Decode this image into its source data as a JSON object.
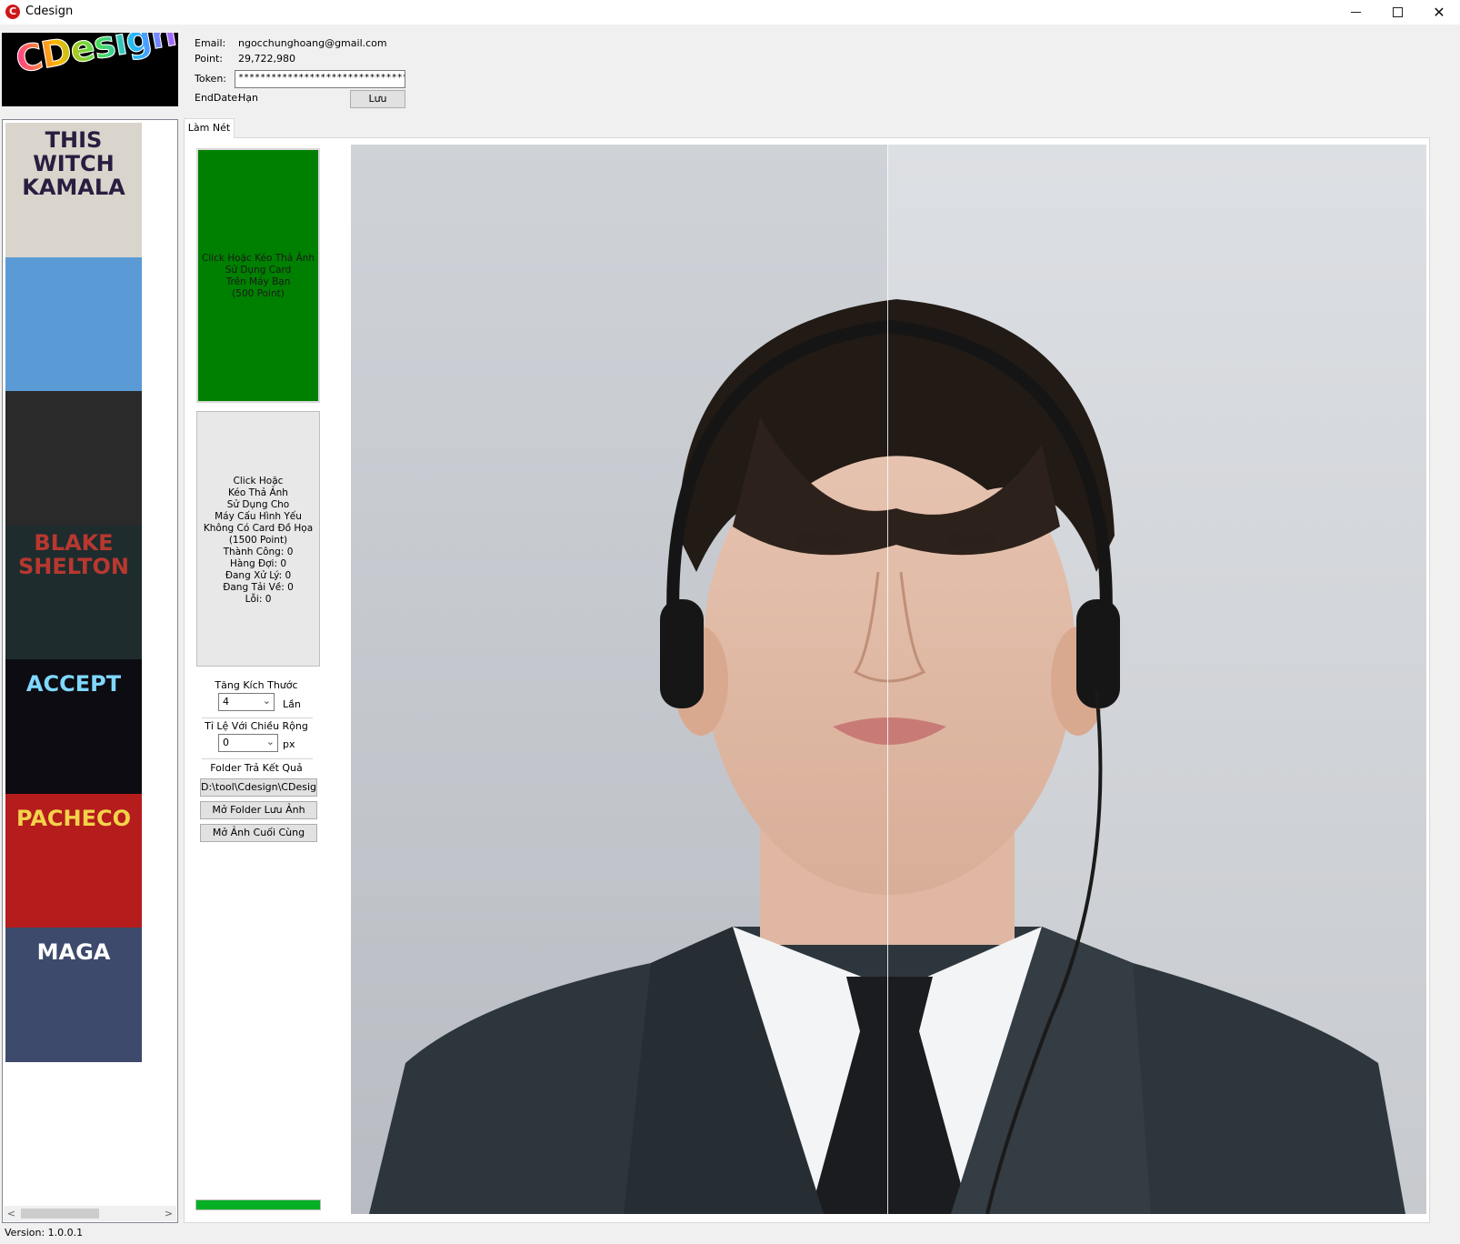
{
  "window": {
    "title": "Cdesign",
    "app_icon": "cdesign-logo-icon"
  },
  "logo": {
    "text": "CDesign"
  },
  "account": {
    "email_label": "Email:",
    "email": "ngocchunghoang@gmail.com",
    "point_label": "Point:",
    "point": "29,722,980",
    "token_label": "Token:",
    "token": "****************************************",
    "enddate_label": "EndDate:",
    "enddate": "Hạn",
    "save_label": "Lưu"
  },
  "thumbnails": [
    {
      "text": "THIS WITCH KAMALA",
      "bg": "#d9d4cc",
      "fg": "#2b1d40"
    },
    {
      "text": "",
      "bg": "#5b9bd5",
      "fg": "#1f3b63"
    },
    {
      "text": "",
      "bg": "#2a2a2a",
      "fg": "#c0392b"
    },
    {
      "text": "BLAKE SHELTON",
      "bg": "#1e2c2e",
      "fg": "#b8382f"
    },
    {
      "text": "ACCEPT",
      "bg": "#0c0c12",
      "fg": "#7fd8ff"
    },
    {
      "text": "PACHECO",
      "bg": "#b51c1c",
      "fg": "#f3d34a"
    },
    {
      "text": "MAGA",
      "bg": "#3d4a6b",
      "fg": "#ffffff"
    }
  ],
  "version": "Version: 1.0.0.1",
  "tab": {
    "label": "Làm Nét"
  },
  "controls": {
    "drop_gpu_text": "Click Hoặc Kéo Thả Ảnh\nSử Dụng Card\nTrên Máy Bạn\n(500 Point)",
    "drop_gpu_color": "#008000",
    "drop_cpu_text": "Click Hoặc\nKéo Thả Ảnh\nSử Dụng Cho\nMáy Cấu Hình Yếu\nKhông Có Card Đồ Họa\n(1500 Point)\nThành Công: 0\nHàng Đợi: 0\nĐang Xử Lý: 0\nĐang Tải Về: 0\nLỗi: 0",
    "scale_label": "Tăng Kích Thước",
    "scale_value": "4",
    "scale_unit": "Lần",
    "width_label": "Tỉ Lệ Với Chiều Rộng",
    "width_value": "0",
    "width_unit": "px",
    "folder_label": "Folder Trả Kết Quả",
    "folder_path": "D:\\tool\\Cdesign\\CDesig",
    "open_folder_label": "Mở Folder Lưu Ảnh",
    "open_last_label": "Mở Ảnh Cuối Cùng",
    "progress_percent": 100,
    "progress_color": "#06b025"
  }
}
